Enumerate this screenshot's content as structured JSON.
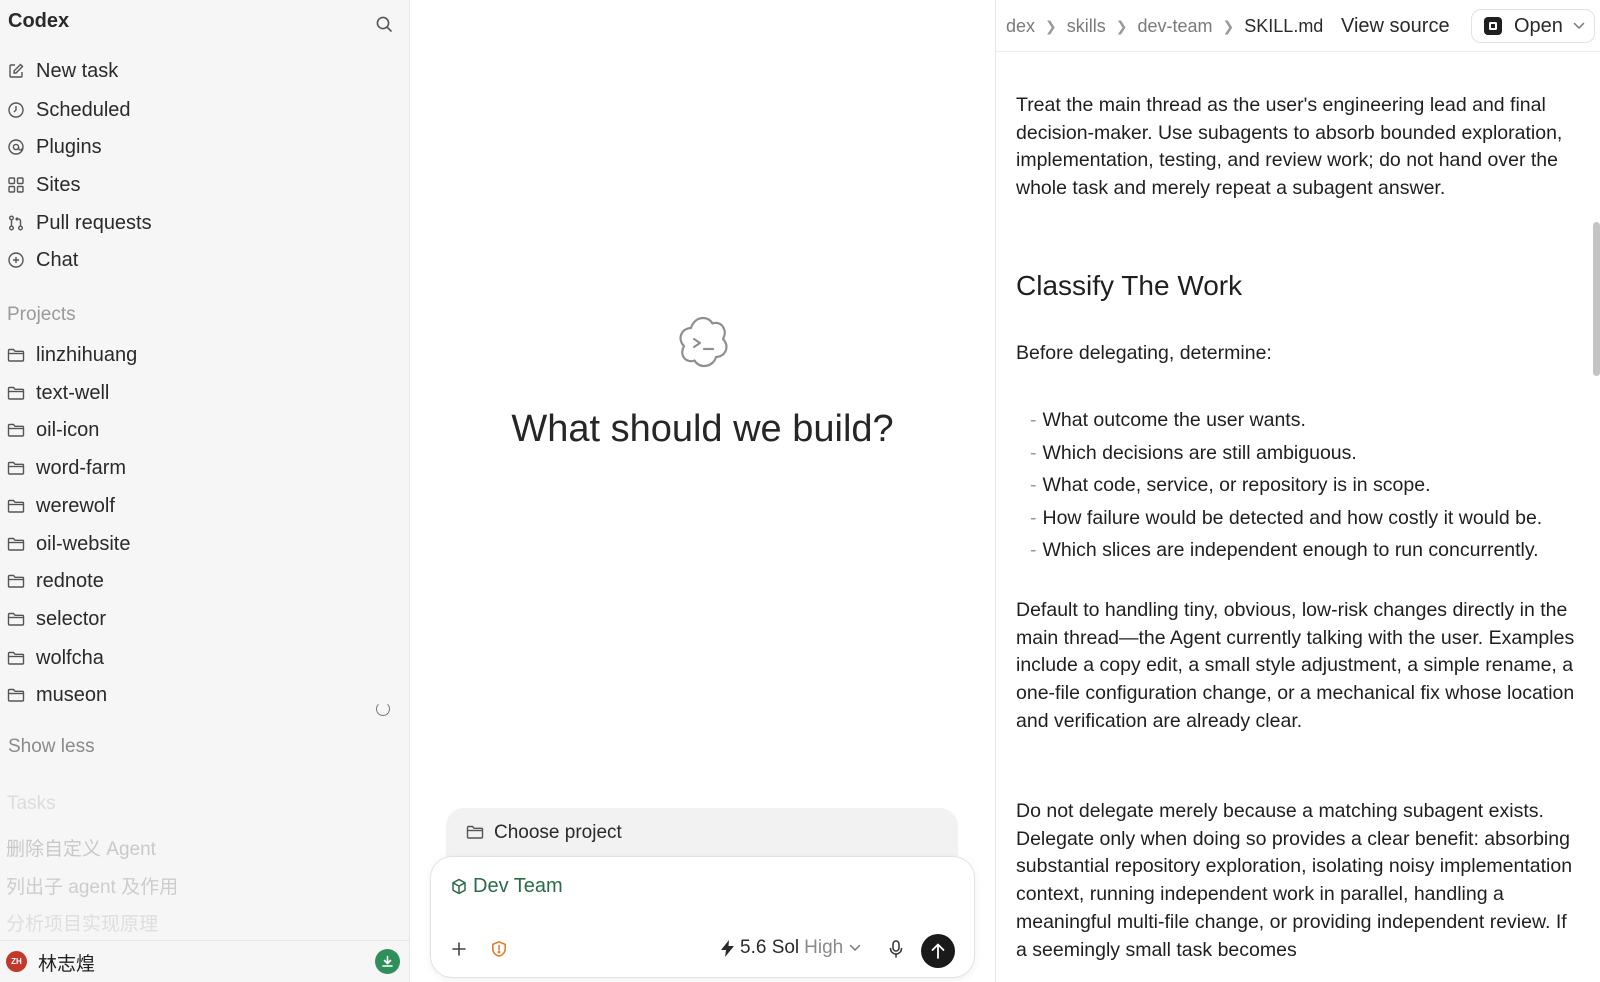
{
  "app": {
    "title": "Codex"
  },
  "sidebar": {
    "nav": [
      {
        "label": "New task",
        "icon": "compose-icon"
      },
      {
        "label": "Scheduled",
        "icon": "clock-icon"
      },
      {
        "label": "Plugins",
        "icon": "at-icon"
      },
      {
        "label": "Sites",
        "icon": "grid-icon"
      },
      {
        "label": "Pull requests",
        "icon": "git-pull-request-icon"
      },
      {
        "label": "Chat",
        "icon": "plus-circle-icon"
      }
    ],
    "projects_label": "Projects",
    "projects": [
      "linzhihuang",
      "text-well",
      "oil-icon",
      "word-farm",
      "werewolf",
      "oil-website",
      "rednote",
      "selector",
      "wolfcha",
      "museon"
    ],
    "show_less": "Show less",
    "tasks_label": "Tasks",
    "tasks": [
      "删除自定义 Agent",
      "列出子 agent 及作用",
      "分析项目实现原理"
    ],
    "user": {
      "initials": "ZH",
      "name": "林志煌",
      "avatar_color": "#c0392b"
    }
  },
  "center": {
    "headline": "What should we build?",
    "choose_project": "Choose project",
    "agent": "Dev Team",
    "model": "5.6 Sol",
    "effort": "High"
  },
  "right": {
    "breadcrumb": [
      "dex",
      "skills",
      "dev-team",
      "SKILL.md"
    ],
    "view_source": "View source",
    "open_label": "Open",
    "doc": {
      "p1": "Treat the main thread as the user's engineering lead and final decision-maker. Use subagents to absorb bounded exploration, implementation, testing, and review work; do not hand over the whole task and merely repeat a subagent answer.",
      "h2": "Classify The Work",
      "p2": "Before delegating, determine:",
      "bullets": [
        "What outcome the user wants.",
        "Which decisions are still ambiguous.",
        "What code, service, or repository is in scope.",
        "How failure would be detected and how costly it would be.",
        "Which slices are independent enough to run concurrently."
      ],
      "p3": "Default to handling tiny, obvious, low-risk changes directly in the main thread—the Agent currently talking with the user. Examples include a copy edit, a small style adjustment, a simple rename, a one-file configuration change, or a mechanical fix whose location and verification are already clear.",
      "p4": "Do not delegate merely because a matching subagent exists. Delegate only when doing so provides a clear benefit: absorbing substantial repository exploration, isolating noisy implementation context, running independent work in parallel, handling a meaningful multi-file change, or providing independent review. If a seemingly small task becomes"
    }
  },
  "colors": {
    "agent_green": "#2a6b48",
    "update_green": "#2f8f5b",
    "warning_orange": "#e07a1f",
    "send_button": "#1a1a1a"
  }
}
